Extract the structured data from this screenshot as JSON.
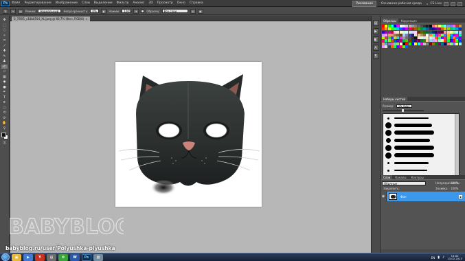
{
  "menubar": {
    "logo": "Ps",
    "items": [
      "Файл",
      "Редактирование",
      "Изображение",
      "Слои",
      "Выделение",
      "Фильтр",
      "Анализ",
      "3D",
      "Просмотр",
      "Окно",
      "Справка"
    ],
    "right": {
      "active_button": "Рисование",
      "workspace": "Основная рабочая среда",
      "live": "CS Live"
    }
  },
  "options_bar": {
    "mode_label": "Режим:",
    "mode_value": "Нормальный",
    "opacity_label": "Непрозрачность:",
    "opacity_value": "0%",
    "flow_label": "Нажим:",
    "flow_value": "100%",
    "sample_label": "Образец:",
    "sample_value": "Все слои"
  },
  "document": {
    "tab_title": "0_786f1_c18b8594_XL.jpeg @ 66,7% (Фон, RGB/8)"
  },
  "brush_panel": {
    "tabs": [
      "Наборы кистей"
    ],
    "size_label": "Размер:",
    "size_value": "95 пикс",
    "rows": [
      "",
      "",
      "",
      "",
      "",
      "",
      "",
      "",
      ""
    ]
  },
  "swatches_panel": {
    "tabs": [
      "Образцы",
      "Коррекция"
    ],
    "colors": [
      "#ff0000",
      "#ffff00",
      "#00ff00",
      "#00ffff",
      "#0000ff",
      "#ff00ff",
      "#ffffff",
      "#e6e6e6",
      "#cccccc",
      "#b3b3b3",
      "#999999",
      "#808080",
      "#666666",
      "#4d4d4d",
      "#333333",
      "#1a1a1a",
      "#000000",
      "#ff6666",
      "#ffcc66",
      "#ffff66",
      "#66ff66",
      "#66ffff",
      "#6699ff",
      "#9966ff",
      "#ff66cc",
      "#cc3333",
      "#cc9933",
      "#ff3300",
      "#ff9900",
      "#ccff00",
      "#33ff00",
      "#00ff99",
      "#00ccff",
      "#0066ff",
      "#6600ff",
      "#cc00ff",
      "#ff0066",
      "#993300",
      "#996600",
      "#669900",
      "#009933",
      "#009999",
      "#006699",
      "#003399",
      "#330099",
      "#660099",
      "#990066",
      "#cc6600",
      "#cccc00",
      "#99cc00",
      "#00cc66",
      "#00cccc",
      "#0099cc",
      "#0033cc",
      "#3300cc",
      "#9900cc",
      "#cc0099",
      "#cc0033",
      "#ffcccc",
      "#ffe6cc",
      "#ffffcc",
      "#ccffcc",
      "#ccffff",
      "#cce6ff",
      "#e6ccff",
      "#ffccff",
      "#663300",
      "#666600",
      "#336600",
      "#006633",
      "#006666",
      "#003366",
      "#330066",
      "#660066",
      "#660033",
      "#ff9999",
      "#ffcc99",
      "#ffff99",
      "#99ff99",
      "#99ffff",
      "#99ccff",
      "#cc99ff",
      "#ff99ff",
      "#ff9966",
      "#c8a070",
      "#a07850",
      "#806040",
      "#604020",
      "#c0c0ff",
      "#8080c0",
      "#4040a0",
      "#202060",
      "#f0e0c0",
      "#e0c090",
      "#b09060",
      "#907040",
      "#f8f8f8",
      "#ff8040",
      "#40ff80",
      "#8040ff",
      "#ff4080",
      "#80ff40",
      "#4080ff",
      "#ffb000",
      "#00b0ff",
      "#b000ff",
      "#ff00b0",
      "#00ffb0",
      "#b0ff00",
      "#d04040",
      "#40d040",
      "#4040d0",
      "#d0d040",
      "#40d0d0",
      "#d040d0",
      "#a0a0a0",
      "#707070",
      "#505050",
      "#303030",
      "#101010",
      "#ffe0e0",
      "#e0ffe0",
      "#e0e0ff",
      "#fff0c0",
      "#c0fff0",
      "#f0c0ff",
      "#ff6020",
      "#20ff60",
      "#6020ff",
      "#ff2060",
      "#60ff20",
      "#2060ff",
      "#ff8000",
      "#0080ff",
      "#8000ff",
      "#ff0080",
      "#00ff80",
      "#80ff00",
      "#c06000",
      "#0060c0",
      "#6000c0",
      "#c00060",
      "#00c060",
      "#60c000",
      "#804000",
      "#004080",
      "#400080",
      "#800040",
      "#008040",
      "#408000",
      "#ffd0a0",
      "#a0d0ff",
      "#d0a0ff",
      "#ffa0d0",
      "#a0ffd0",
      "#d0ffa0",
      "#ff4000",
      "#00ff40",
      "#4000ff",
      "#ff0040",
      "#40ff00",
      "#0040ff",
      "#e0a060",
      "#60a0e0",
      "#a060e0",
      "#e060a0",
      "#60e0a0",
      "#a0e060",
      "#ffffff",
      "#000000",
      "#ff0000",
      "#00ff00",
      "#0000ff",
      "#ffff00",
      "#00ffff",
      "#ff00ff",
      "#c0c0c0",
      "#808080",
      "#800000",
      "#808000",
      "#008000",
      "#800080",
      "#008080",
      "#000080",
      "#ff8080",
      "#80ff80",
      "#8080ff",
      "#ffff80",
      "#80ffff",
      "#ff80ff",
      "#e0e0e0",
      "#404040",
      "#ff6000",
      "#00ff60",
      "#6000ff",
      "#ff0060",
      "#60ff00",
      "#0060ff"
    ]
  },
  "layers_panel": {
    "tabs": [
      "Слои",
      "Каналы",
      "Контуры"
    ],
    "blend_mode": "Обычные",
    "opacity_label": "Непрозрачность:",
    "opacity_value": "100%",
    "lock_label": "Закрепить:",
    "fill_label": "Заливка:",
    "fill_value": "100%",
    "layers": [
      {
        "name": "Фон",
        "selected": true
      }
    ]
  },
  "watermark": {
    "logo_text": "BABYBLOG",
    "url": "babyblog.ru/user/Polyushka-plyushka"
  },
  "taskbar": {
    "lang": "EN",
    "time": "14:02",
    "date": "13.02.2013"
  },
  "colors": {
    "accent_selected_layer": "#3b98ea",
    "document_background": "#b7b7b7",
    "canvas_background": "#ffffff",
    "cat_body": "#2b2f2e"
  }
}
